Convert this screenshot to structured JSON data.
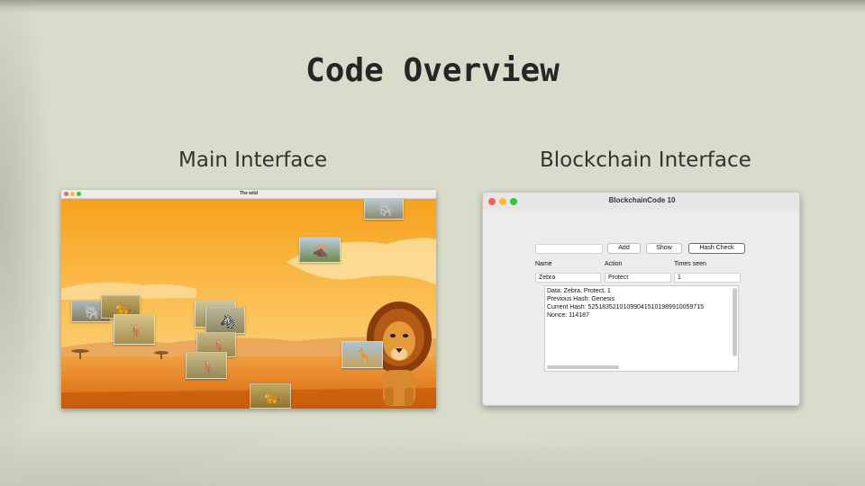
{
  "slide": {
    "title": "Code Overview",
    "left_caption": "Main Interface",
    "right_caption": "Blockchain Interface"
  },
  "main_window": {
    "title": "The wild",
    "photos": [
      {
        "animal": "elephant",
        "icon": "🐘"
      },
      {
        "animal": "moose",
        "icon": "🫎"
      },
      {
        "animal": "elephant",
        "icon": "🐘"
      },
      {
        "animal": "cheetah",
        "icon": "🐆"
      },
      {
        "animal": "gazelle",
        "icon": "🦌"
      },
      {
        "animal": "gazelle",
        "icon": "🦌"
      },
      {
        "animal": "zebra",
        "icon": "🦓"
      },
      {
        "animal": "gazelle",
        "icon": "🦌"
      },
      {
        "animal": "gazelle",
        "icon": "🦌"
      },
      {
        "animal": "giraffe",
        "icon": "🦒"
      },
      {
        "animal": "cheetah",
        "icon": "🐆"
      }
    ],
    "lion_icon": "🦁"
  },
  "chain_window": {
    "title": "BlockchainCode 10",
    "input_value": "",
    "buttons": {
      "add": "Add",
      "show": "Show",
      "hash_check": "Hash Check"
    },
    "columns": {
      "name": "Name",
      "action": "Action",
      "times": "Times seen"
    },
    "row": {
      "name": "Zebra",
      "action": "Protect",
      "times": "1"
    },
    "output_lines": [
      "Data: Zebra, Protect, 1",
      "Previous Hash: Genesis",
      "Current Hash: 525183521010990415101989910059715",
      "Nonce: 114187"
    ]
  },
  "colors": {
    "background": "#d9dccb",
    "close": "#ff5f57",
    "minimize": "#febc2e",
    "maximize": "#28c840",
    "sky_top": "#f59a1c",
    "ground": "#e07a12"
  }
}
